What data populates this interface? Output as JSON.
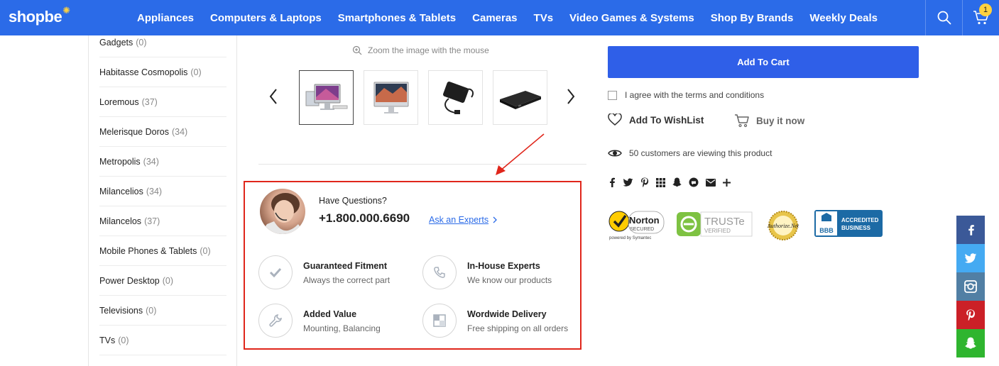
{
  "header": {
    "logo": "shopbe",
    "nav": [
      "Appliances",
      "Computers & Laptops",
      "Smartphones & Tablets",
      "Cameras",
      "TVs",
      "Video Games & Systems",
      "Shop By Brands",
      "Weekly Deals"
    ],
    "cart_count": "1"
  },
  "sidebar": {
    "items": [
      {
        "label": "Gadgets",
        "count": "(0)"
      },
      {
        "label": "Habitasse Cosmopolis",
        "count": "(0)"
      },
      {
        "label": "Loremous",
        "count": "(37)"
      },
      {
        "label": "Melerisque Doros",
        "count": "(34)"
      },
      {
        "label": "Metropolis",
        "count": "(34)"
      },
      {
        "label": "Milancelios",
        "count": "(34)"
      },
      {
        "label": "Milancelos",
        "count": "(37)"
      },
      {
        "label": "Mobile Phones & Tablets",
        "count": "(0)"
      },
      {
        "label": "Power Desktop",
        "count": "(0)"
      },
      {
        "label": "Televisions",
        "count": "(0)"
      },
      {
        "label": "TVs",
        "count": "(0)"
      }
    ]
  },
  "gallery": {
    "zoom_hint": "Zoom the image with the mouse"
  },
  "questions": {
    "title": "Have Questions?",
    "phone": "+1.800.000.6690",
    "link": "Ask an Experts"
  },
  "features": [
    {
      "title": "Guaranteed Fitment",
      "sub": "Always the correct part"
    },
    {
      "title": "In-House Experts",
      "sub": "We know our products"
    },
    {
      "title": "Added Value",
      "sub": "Mounting, Balancing"
    },
    {
      "title": "Wordwide Delivery",
      "sub": "Free shipping on all orders"
    }
  ],
  "product": {
    "add_to_cart": "Add To Cart",
    "terms": "I agree with the terms and conditions",
    "wishlist": "Add To WishList",
    "buy_now": "Buy it now",
    "viewers": "50 customers are viewing this product"
  },
  "badges": {
    "norton": "Norton",
    "norton_sub": "SECURED",
    "norton_powered": "powered by Symantec",
    "truste": "TRUSTe",
    "truste_sub": "VERIFIED",
    "authorize": "Authorize.Net",
    "bbb": "BBB",
    "bbb_text_1": "ACCREDITED",
    "bbb_text_2": "BUSINESS"
  },
  "colors": {
    "brand": "#2b6be8",
    "button": "#2f5fe8",
    "highlight_box": "#e0261b",
    "facebook": "#3b5998",
    "twitter": "#45aaf2",
    "instagram": "#517fa4",
    "pinterest": "#cb2027",
    "snapchat": "#2fb52f"
  }
}
